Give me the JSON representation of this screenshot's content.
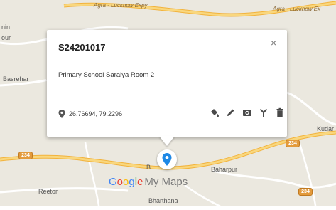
{
  "map": {
    "place_labels": {
      "top_left_1": "nin",
      "top_left_2": "our",
      "basrehar": "Basrehar",
      "kudar": "Kudar",
      "b": "B",
      "baharpur": "Baharpur",
      "reetor": "Reetor",
      "bharthana": "Bharthana"
    },
    "road_labels": {
      "expy_top": "Agra - Lucknow Expy",
      "expy_right": "Agra - Lucknow Ex"
    },
    "shields": [
      "234",
      "234",
      "234"
    ],
    "colors": {
      "land": "#ebe8df",
      "major_road": "#f6cf65",
      "minor_road": "#ffffff",
      "marker_blue": "#1e88e5"
    }
  },
  "info_window": {
    "title": "S24201017",
    "close_label": "×",
    "description": "Primary School Saraiya Room 2",
    "coordinates": "26.76694, 79.2296",
    "actions": [
      "style-paint-icon",
      "edit-pencil-icon",
      "camera-icon",
      "directions-icon",
      "delete-trash-icon"
    ]
  },
  "logo": {
    "google_letters": [
      "G",
      "o",
      "o",
      "g",
      "l",
      "e"
    ],
    "google_colors": [
      "#4285f4",
      "#ea4335",
      "#fbbc05",
      "#4285f4",
      "#34a853",
      "#ea4335"
    ],
    "product": "My Maps"
  }
}
